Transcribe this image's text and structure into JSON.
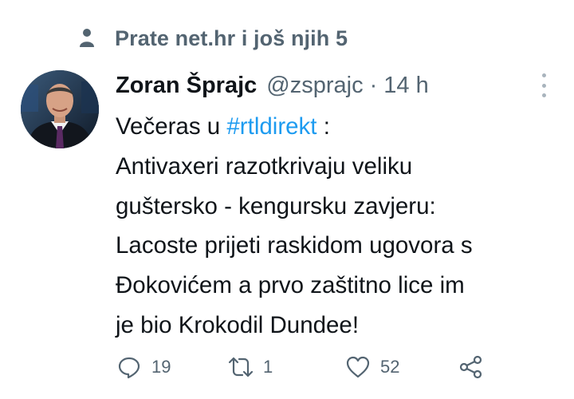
{
  "social_context": {
    "text": "Prate net.hr i još njih 5",
    "icon": "person-icon"
  },
  "tweet": {
    "author_name": "Zoran Šprajc",
    "handle": "@zsprajc",
    "separator": "·",
    "time": "14 h",
    "avatar": "author-avatar",
    "body": {
      "line1_prefix": "Večeras u ",
      "hashtag": "#rtldirekt",
      "line1_suffix": " :",
      "line2": "Antivaxeri razotkrivaju veliku",
      "line3": "guštersko - kengursku zavjeru:",
      "line4": "Lacoste prijeti raskidom ugovora s",
      "line5": "Đokovićem a prvo zaštitno lice im",
      "line6": "je bio Krokodil Dundee!"
    },
    "actions": {
      "reply_count": "19",
      "retweet_count": "1",
      "like_count": "52"
    }
  },
  "colors": {
    "accent": "#1d9bf0",
    "secondary_text": "#536471",
    "primary_text": "#0f1419"
  }
}
